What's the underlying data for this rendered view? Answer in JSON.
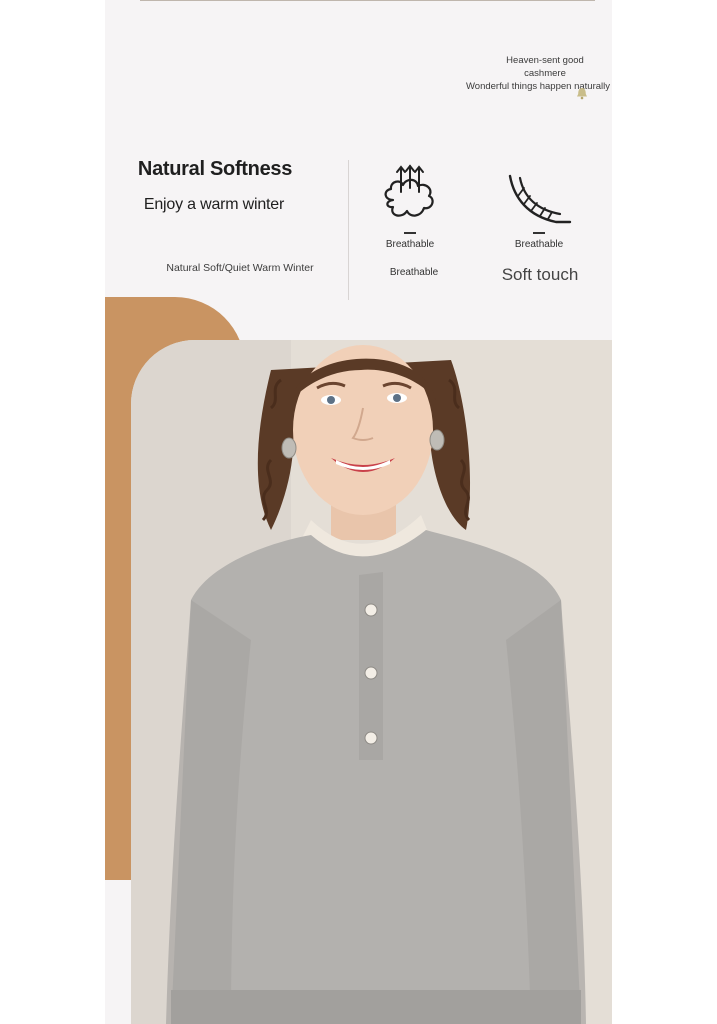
{
  "slogan": {
    "line1": "Heaven-sent good",
    "line2": "cashmere",
    "line3": "Wonderful things happen naturally"
  },
  "headline": "Natural Softness",
  "subline": "Enjoy a warm winter",
  "caption": "Natural Soft/Quiet Warm Winter",
  "features": [
    {
      "icon": "breathable-cloud-icon",
      "label": "Breathable",
      "sub": "Breathable"
    },
    {
      "icon": "feather-icon",
      "label": "Breathable",
      "sub": "Soft touch"
    }
  ],
  "colors": {
    "panel_bg": "#f6f4f5",
    "accent_tan": "#c99462",
    "text_dark": "#1f1f1f",
    "sweater_gray": "#b3b1ae"
  }
}
